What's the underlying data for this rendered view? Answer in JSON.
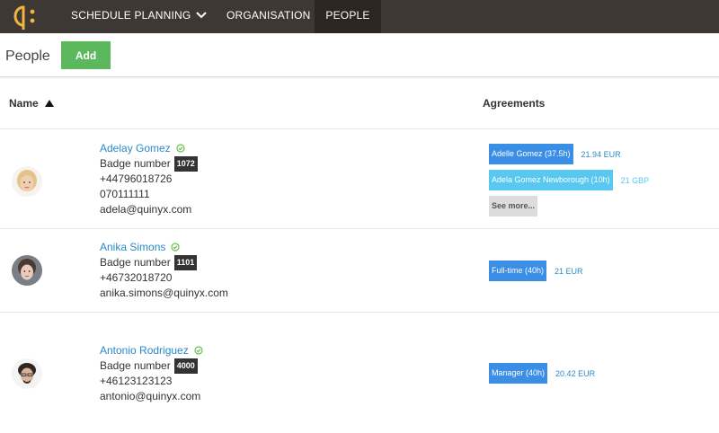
{
  "nav": {
    "logo_icon": "quinyx-logo-icon",
    "items": [
      {
        "label": "SCHEDULE PLANNING"
      },
      {
        "label": "ORGANISATION"
      },
      {
        "label": "PEOPLE"
      }
    ]
  },
  "page": {
    "title": "People",
    "add_label": "Add"
  },
  "table": {
    "headers": {
      "name": "Name",
      "agreements": "Agreements"
    },
    "people": [
      {
        "name": "Adelay Gomez",
        "badge_label": "Badge number",
        "badge": "1072",
        "phone1": "+44796018726",
        "phone2": "070111111",
        "email": "adela@quinyx.com",
        "agreements": [
          {
            "label": "Adelle Gomez (37.5h)",
            "amount": "21.94 EUR"
          },
          {
            "label": "Adela Gomez Newborough (10h)",
            "amount": "21 GBP"
          }
        ],
        "see_more": "See more..."
      },
      {
        "name": "Anika Simons",
        "badge_label": "Badge number",
        "badge": "1101",
        "phone1": "+46732018720",
        "email": "anika.simons@quinyx.com",
        "agreements": [
          {
            "label": "Full-time (40h)",
            "amount": "21 EUR"
          }
        ]
      },
      {
        "name": "Antonio Rodriguez",
        "badge_label": "Badge number",
        "badge": "4000",
        "phone1": "+46123123123",
        "email": "antonio@quinyx.com",
        "agreements": [
          {
            "label": "Manager (40h)",
            "amount": "20.42 EUR"
          }
        ]
      }
    ]
  },
  "colors": {
    "topbar": "#3d3834",
    "active_nav": "#2b2622",
    "add_button": "#5cb85c",
    "link": "#2a8ac8",
    "agreement_primary": "#3a8ee6",
    "agreement_secondary": "#58c8f0",
    "verified": "#6cc04a"
  }
}
